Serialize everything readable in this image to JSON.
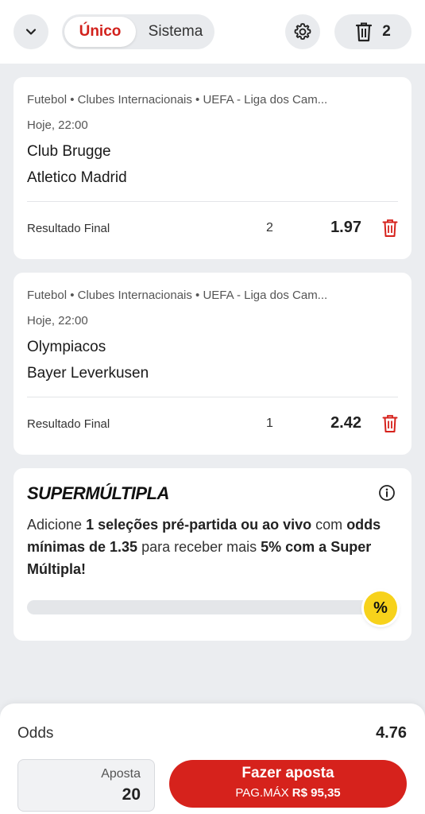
{
  "header": {
    "segment": {
      "active": "Único",
      "inactive": "Sistema"
    },
    "selection_count": "2",
    "icons": {
      "collapse": "chevron-down-icon",
      "settings": "gear-icon",
      "clear": "trash-icon"
    }
  },
  "bets": [
    {
      "breadcrumb": "Futebol • Clubes Internacionais • UEFA - Liga dos Cam...",
      "time": "Hoje, 22:00",
      "home": "Club Brugge",
      "away": "Atletico Madrid",
      "market": "Resultado Final",
      "selection": "2",
      "odd": "1.97"
    },
    {
      "breadcrumb": "Futebol • Clubes Internacionais • UEFA - Liga dos Cam...",
      "time": "Hoje, 22:00",
      "home": "Olympiacos",
      "away": "Bayer Leverkusen",
      "market": "Resultado Final",
      "selection": "1",
      "odd": "2.42"
    }
  ],
  "promo": {
    "title": "SUPERMÚLTIPLA",
    "t1": "Adicione ",
    "b1": "1 seleções pré-partida ou ao vivo",
    "t2": " com ",
    "b2": "odds mínimas de 1.35",
    "t3": " para receber mais ",
    "b3": "5% com a Super Múltipla!",
    "progress": 0.0,
    "badge": "%"
  },
  "footer": {
    "odds_label": "Odds",
    "odds_value": "4.76",
    "stake_label": "Aposta",
    "stake_value": "20",
    "place_label": "Fazer aposta",
    "maxpay_label": "PAG.MÁX",
    "maxpay_value": "R$ 95,35"
  },
  "colors": {
    "brand_red": "#d6221c",
    "badge_yellow": "#f7d21b",
    "background": "#ebedf0"
  }
}
